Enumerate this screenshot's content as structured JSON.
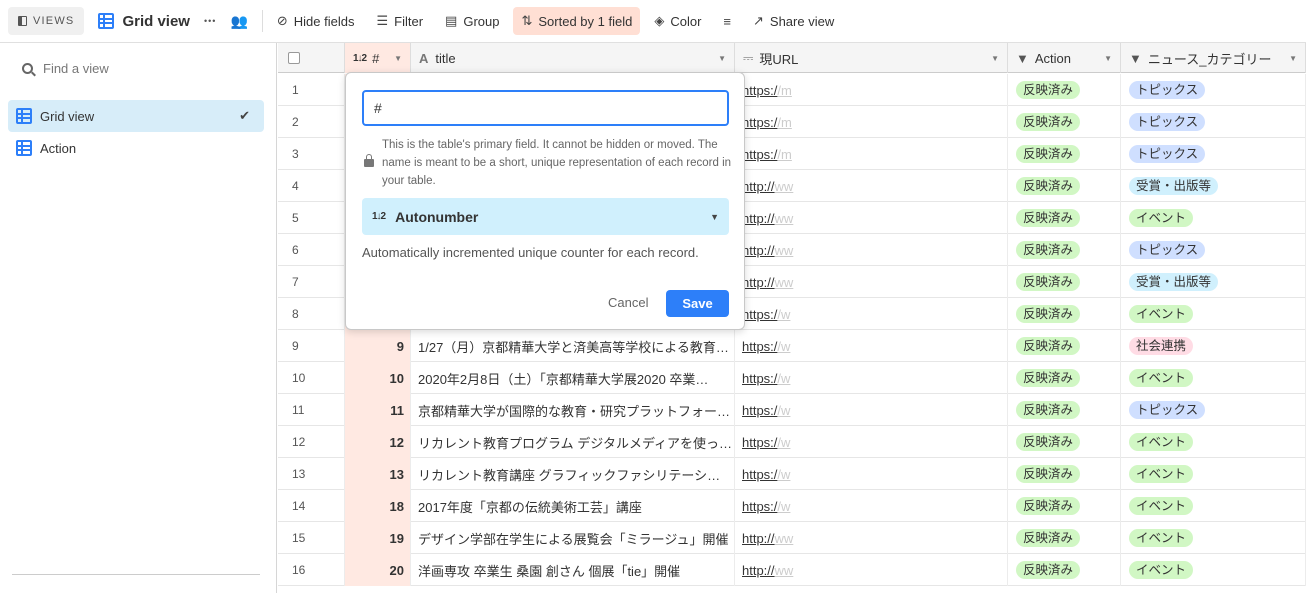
{
  "toolbar": {
    "views_label": "VIEWS",
    "view_name": "Grid view",
    "more_label": "•••",
    "hide_fields": "Hide fields",
    "filter": "Filter",
    "group": "Group",
    "sorted": "Sorted by 1 field",
    "color": "Color",
    "share_view": "Share view",
    "sorted_bg": "#ffdfd4"
  },
  "sidebar": {
    "find_placeholder": "Find a view",
    "items": [
      {
        "label": "Grid view",
        "active": true
      },
      {
        "label": "Action",
        "active": false
      }
    ]
  },
  "grid": {
    "headers": {
      "num": "#",
      "title": "title",
      "url": "現URL",
      "action": "Action",
      "category": "ニュース_カテゴリー"
    },
    "rows": [
      {
        "idx": "1",
        "num": "",
        "title": "",
        "url": "https:/",
        "url_fade": "/m",
        "action": "反映済み",
        "cat": "トピックス",
        "cat_color": "blue"
      },
      {
        "idx": "2",
        "num": "",
        "title": "",
        "url": "https:/",
        "url_fade": "/m",
        "action": "反映済み",
        "cat": "トピックス",
        "cat_color": "blue"
      },
      {
        "idx": "3",
        "num": "",
        "title": "",
        "url": "https:/",
        "url_fade": "/m",
        "action": "反映済み",
        "cat": "トピックス",
        "cat_color": "blue"
      },
      {
        "idx": "4",
        "num": "",
        "title": "",
        "url": "http://",
        "url_fade": "ww",
        "action": "反映済み",
        "cat": "受賞・出版等",
        "cat_color": "cyan"
      },
      {
        "idx": "5",
        "num": "",
        "title": "",
        "url": "http://",
        "url_fade": "ww",
        "action": "反映済み",
        "cat": "イベント",
        "cat_color": "green"
      },
      {
        "idx": "6",
        "num": "",
        "title": "",
        "url": "http://",
        "url_fade": "ww",
        "action": "反映済み",
        "cat": "トピックス",
        "cat_color": "blue"
      },
      {
        "idx": "7",
        "num": "",
        "title": "",
        "url": "http://",
        "url_fade": "ww",
        "action": "反映済み",
        "cat": "受賞・出版等",
        "cat_color": "cyan"
      },
      {
        "idx": "8",
        "num": "",
        "title": "",
        "url": "https:/",
        "url_fade": "/w",
        "action": "反映済み",
        "cat": "イベント",
        "cat_color": "green"
      },
      {
        "idx": "9",
        "num": "9",
        "title": "1/27（月）京都精華大学と済美高等学校による教育…",
        "url": "https:/",
        "url_fade": "/w",
        "action": "反映済み",
        "cat": "社会連携",
        "cat_color": "red"
      },
      {
        "idx": "10",
        "num": "10",
        "title": "2020年2月8日（土）「京都精華大学展2020 卒業…",
        "url": "https:/",
        "url_fade": "/w",
        "action": "反映済み",
        "cat": "イベント",
        "cat_color": "green"
      },
      {
        "idx": "11",
        "num": "11",
        "title": "京都精華大学が国際的な教育・研究プラットフォー…",
        "url": "https:/",
        "url_fade": "/w",
        "action": "反映済み",
        "cat": "トピックス",
        "cat_color": "blue"
      },
      {
        "idx": "12",
        "num": "12",
        "title": "リカレント教育プログラム デジタルメディアを使っ…",
        "url": "https:/",
        "url_fade": "/w",
        "action": "反映済み",
        "cat": "イベント",
        "cat_color": "green"
      },
      {
        "idx": "13",
        "num": "13",
        "title": "リカレント教育講座 グラフィックファシリテーシ…",
        "url": "https:/",
        "url_fade": "/w",
        "action": "反映済み",
        "cat": "イベント",
        "cat_color": "green"
      },
      {
        "idx": "14",
        "num": "18",
        "title": "2017年度「京都の伝統美術工芸」講座",
        "url": "https:/",
        "url_fade": "/w",
        "action": "反映済み",
        "cat": "イベント",
        "cat_color": "green"
      },
      {
        "idx": "15",
        "num": "19",
        "title": "デザイン学部在学生による展覧会「ミラージュ」開催",
        "url": "http://",
        "url_fade": "ww",
        "action": "反映済み",
        "cat": "イベント",
        "cat_color": "green"
      },
      {
        "idx": "16",
        "num": "20",
        "title": "洋画専攻 卒業生 桑園 創さん 個展「tie」開催",
        "url": "http://",
        "url_fade": "ww",
        "action": "反映済み",
        "cat": "イベント",
        "cat_color": "green"
      }
    ]
  },
  "popover": {
    "field_name": "#",
    "note": "This is the table's primary field. It cannot be hidden or moved. The name is meant to be a short, unique representation of each record in your table.",
    "type": "Autonumber",
    "description": "Automatically incremented unique counter for each record.",
    "cancel": "Cancel",
    "save": "Save",
    "accent": "#2d7ff9"
  }
}
